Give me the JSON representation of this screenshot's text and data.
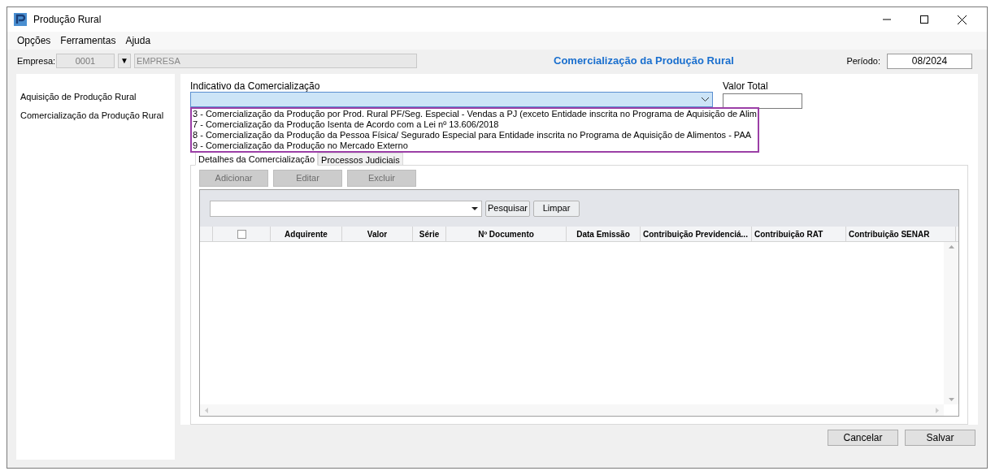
{
  "window": {
    "title": "Produção Rural"
  },
  "menu": [
    "Opções",
    "Ferramentas",
    "Ajuda"
  ],
  "empresa": {
    "label": "Empresa:",
    "code": "0001",
    "dropdown": "▼",
    "name": "EMPRESA"
  },
  "heading": "Comercialização da Produção Rural",
  "periodo": {
    "label": "Período:",
    "value": "08/2024"
  },
  "sidebar": {
    "items": [
      {
        "label": "Aquisição de Produção Rural"
      },
      {
        "label": "Comercialização da Produção Rural"
      }
    ]
  },
  "indicativo": {
    "label": "Indicativo da Comercialização",
    "expanded": true,
    "options": [
      "3 - Comercialização da Produção por Prod. Rural PF/Seg. Especial - Vendas a PJ (exceto Entidade inscrita no Programa de Aquisição de Alim",
      "7 - Comercialização da Produção Isenta de Acordo com a Lei nº 13.606/2018",
      "8 - Comercialização da Produção da Pessoa Física/ Segurado Especial para Entidade inscrita no Programa de Aquisição de Alimentos - PAA",
      "9 - Comercialização da Produção no Mercado Externo"
    ]
  },
  "valor_total": {
    "label": "Valor Total"
  },
  "tabs": [
    {
      "label": "Detalhes da Comercialização",
      "selected": true
    },
    {
      "label": "Processos Judiciais",
      "selected": false
    }
  ],
  "actions": [
    {
      "label": "Adicionar",
      "disabled": true
    },
    {
      "label": "Editar",
      "disabled": true
    },
    {
      "label": "Excluir",
      "disabled": true
    }
  ],
  "search_buttons": [
    "Pesquisar",
    "Limpar"
  ],
  "table": {
    "select_all_checked": false,
    "columns": [
      "Adquirente",
      "Valor",
      "Série",
      "Nº Documento",
      "Data Emissão",
      "Contribuição Previdenciá...",
      "Contribuição RAT",
      "Contribuição SENAR"
    ]
  },
  "footer_buttons": [
    "Cancelar",
    "Salvar"
  ]
}
